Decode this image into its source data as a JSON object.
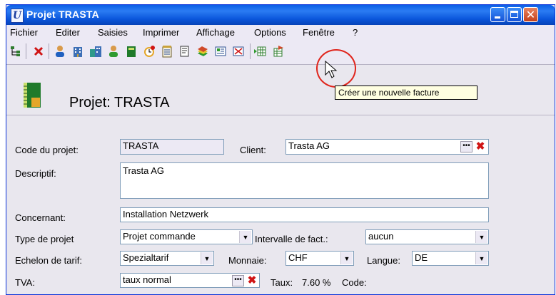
{
  "window": {
    "title": "Projet TRASTA",
    "app_icon_glyph": "U"
  },
  "menu": [
    "Fichier",
    "Editer",
    "Saisies",
    "Imprimer",
    "Affichage",
    "Options",
    "Fenêtre",
    "?"
  ],
  "toolbar": {
    "icons": [
      "tree-icon",
      "delete-icon",
      "person-icon",
      "building-icon",
      "buildings-icon",
      "person-green-icon",
      "book-icon",
      "clock-icon",
      "calendar-icon",
      "document-icon",
      "stack-icon",
      "invoice-icon",
      "new-invoice-icon",
      "grid-icon",
      "export-icon"
    ]
  },
  "tooltip": "Créer une nouvelle facture",
  "header": {
    "title": "Projet: TRASTA"
  },
  "form": {
    "code_label": "Code du projet:",
    "code_value": "TRASTA",
    "client_label": "Client:",
    "client_value": "Trasta AG",
    "descriptif_label": "Descriptif:",
    "descriptif_value": "Trasta AG",
    "concernant_label": "Concernant:",
    "concernant_value": "Installation Netzwerk",
    "type_label": "Type de projet",
    "type_value": "Projet commande",
    "intervalle_label": "Intervalle de fact.:",
    "intervalle_value": "aucun",
    "echelon_label": "Echelon de tarif:",
    "echelon_value": "Spezialtarif",
    "monnaie_label": "Monnaie:",
    "monnaie_value": "CHF",
    "langue_label": "Langue:",
    "langue_value": "DE",
    "tva_label": "TVA:",
    "tva_value": "taux normal",
    "taux_label": "Taux:",
    "taux_value": "7.60 %",
    "code_label2": "Code:"
  }
}
